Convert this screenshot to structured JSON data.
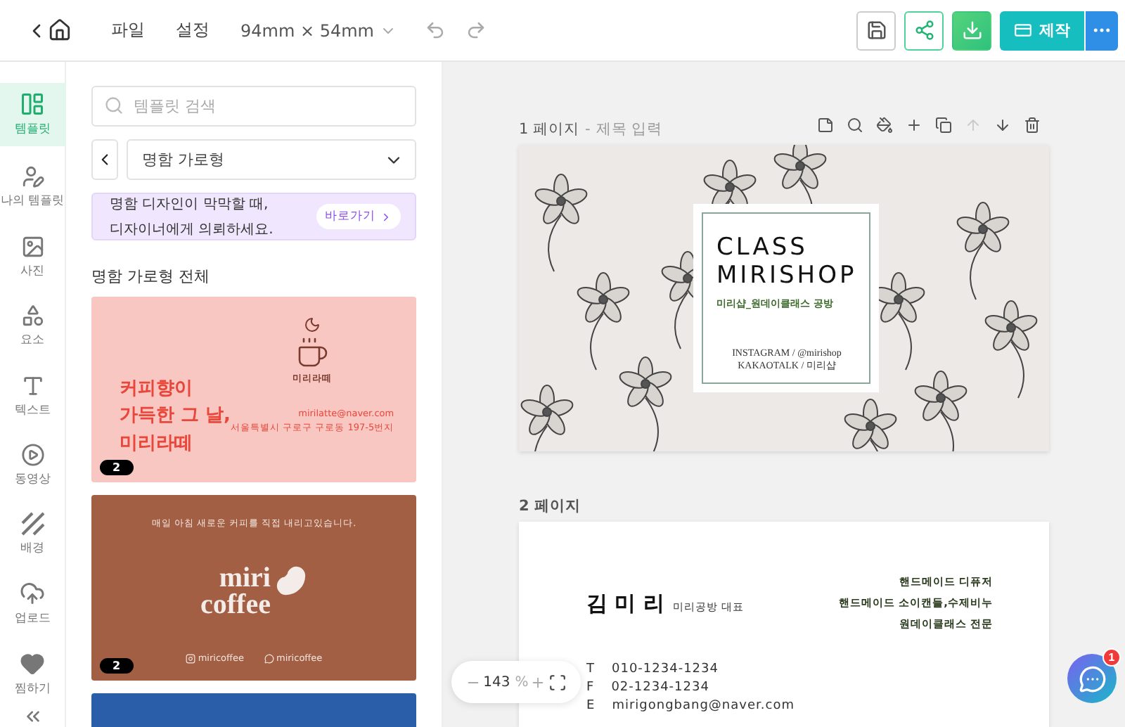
{
  "topbar": {
    "menus": [
      "파일",
      "설정"
    ],
    "size": "94mm × 54mm",
    "make_label": "제작"
  },
  "sidebar": {
    "items": [
      {
        "kind": "template",
        "label": "템플릿",
        "selected": true
      },
      {
        "kind": "mine",
        "label": "나의 템플릿",
        "selected": false
      },
      {
        "kind": "photo",
        "label": "사진",
        "selected": false
      },
      {
        "kind": "element",
        "label": "요소",
        "selected": false
      },
      {
        "kind": "text",
        "label": "텍스트",
        "selected": false
      },
      {
        "kind": "video",
        "label": "동영상",
        "selected": false
      },
      {
        "kind": "background",
        "label": "배경",
        "selected": false
      },
      {
        "kind": "upload",
        "label": "업로드",
        "selected": false
      },
      {
        "kind": "favorite",
        "label": "찜하기",
        "selected": false
      }
    ]
  },
  "panel": {
    "search": {
      "placeholder": "템플릿 검색"
    },
    "category": "명함 가로형",
    "banner": {
      "lines": [
        "명함 디자인이 막막할 때,",
        "디자이너에게 의뢰하세요."
      ],
      "button": "바로가기"
    },
    "section_title": "명함 가로형 전체",
    "templates": [
      {
        "kind": "pink",
        "headline": [
          "커피향이",
          "가득한 그 날,",
          "미리라떼"
        ],
        "brand": "미리라떼",
        "email": "mirilatte@naver.com",
        "address": "서울특별시 구로구 구로동 197-5번지",
        "pages": "2"
      },
      {
        "kind": "brown",
        "tagline": "매일 아침 새로운 커피를 직접 내리고있습니다.",
        "logo": [
          "miri",
          "coffee"
        ],
        "social": [
          "miricoffee",
          "miricoffee"
        ],
        "pages": "2"
      },
      {
        "kind": "blue"
      }
    ]
  },
  "canvas": {
    "pages": [
      {
        "number_label": "1 페이지",
        "separator": "-",
        "title_placeholder": "제목 입력",
        "move_up_disabled": true,
        "card": {
          "kind": "floral",
          "title": [
            "CLASS",
            "MIRISHOP"
          ],
          "subtitle": "미리샵_원데이클래스 공방",
          "contacts": [
            "INSTAGRAM / @mirishop",
            "KAKAOTALK / 미리샵"
          ]
        }
      },
      {
        "number_label": "2 페이지",
        "card": {
          "kind": "profile",
          "name": "김 미 리",
          "role": "미리공방 대표",
          "services": [
            "핸드메이드 디퓨저",
            "핸드메이드 소이캔들,수제비누",
            "원데이클래스 전문"
          ],
          "contacts": [
            {
              "label": "T",
              "value": "010-1234-1234"
            },
            {
              "label": "F",
              "value": "02-1234-1234"
            },
            {
              "label": "E",
              "value": "mirigongbang@naver.com"
            }
          ]
        }
      }
    ]
  },
  "zoom": {
    "value": "143",
    "unit": "%"
  },
  "chat": {
    "badge": "1"
  }
}
